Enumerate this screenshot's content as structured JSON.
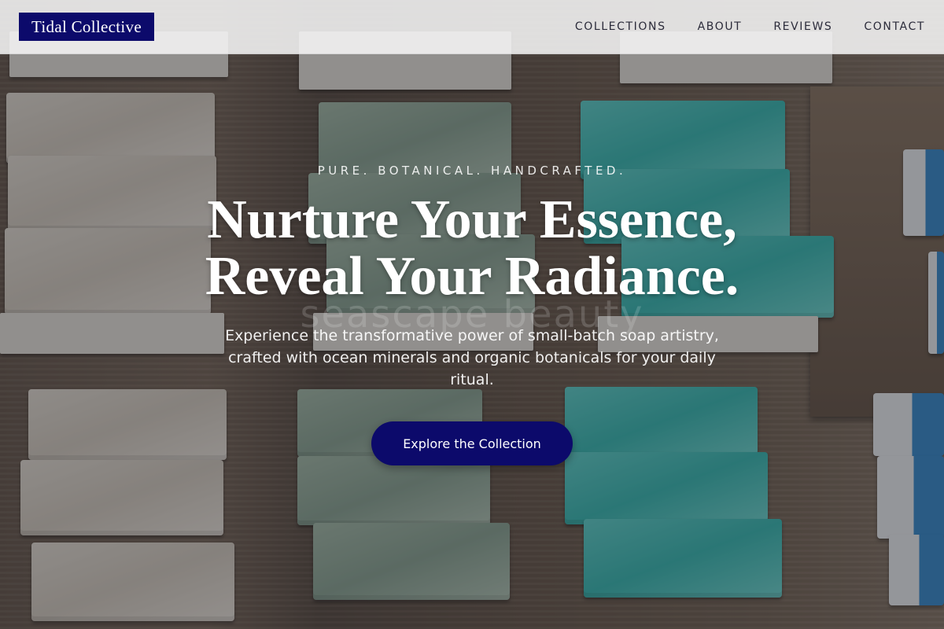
{
  "brand": {
    "name": "Tidal Collective",
    "accent_color": "#0c0a6b"
  },
  "nav": {
    "items": [
      {
        "label": "COLLECTIONS"
      },
      {
        "label": "ABOUT"
      },
      {
        "label": "REVIEWS"
      },
      {
        "label": "CONTACT"
      }
    ]
  },
  "hero": {
    "tagline": "PURE. BOTANICAL. HANDCRAFTED.",
    "headline_line1": "Nurture Your Essence,",
    "headline_line2": "Reveal Your Radiance.",
    "background_text": "seascape beauty",
    "subtext": "Experience the transformative power of small-batch soap artistry, crafted with ocean minerals and organic botanicals for your daily ritual.",
    "cta_label": "Explore the Collection"
  }
}
